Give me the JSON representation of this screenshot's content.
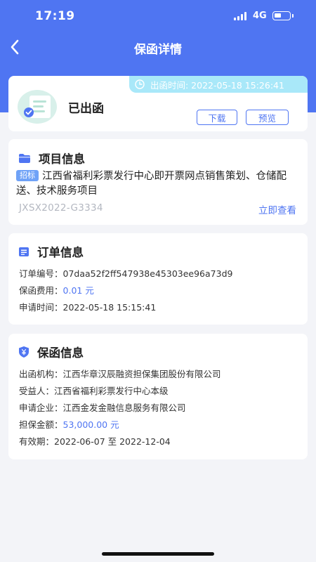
{
  "status_bar": {
    "time": "17:19",
    "network": "4G"
  },
  "nav": {
    "title": "保函详情"
  },
  "status_card": {
    "issue_time": "出函时间: 2022-05-18 15:26:41",
    "status": "已出函",
    "download_label": "下载",
    "preview_label": "预览"
  },
  "project": {
    "section_title": "项目信息",
    "tag": "招标",
    "name": "江西省福利彩票发行中心即开票网点销售策划、仓储配送、技术服务项目",
    "code": "JXSX2022-G3334",
    "view_label": "立即查看"
  },
  "order": {
    "section_title": "订单信息",
    "number_label": "订单编号：",
    "number": "07daa52f2ff547938e45303ee96a73d9",
    "fee_label": "保函费用：",
    "fee": "0.01 元",
    "apply_time_label": "申请时间：",
    "apply_time": "2022-05-18 15:15:41"
  },
  "guarantee": {
    "section_title": "保函信息",
    "institution_label": "出函机构：",
    "institution": "江西华章汉辰融资担保集团股份有限公司",
    "beneficiary_label": "受益人：",
    "beneficiary": "江西省福利彩票发行中心本级",
    "applicant_label": "申请企业：",
    "applicant": "江西金发金融信息服务有限公司",
    "amount_label": "担保金额：",
    "amount": "53,000.00 元",
    "validity_label": "有效期：",
    "validity": "2022-06-07 至 2022-12-04"
  },
  "colors": {
    "primary": "#4f75f2",
    "badge_bg": "#a9e8f9",
    "tag_bg": "#6fa2f7"
  }
}
